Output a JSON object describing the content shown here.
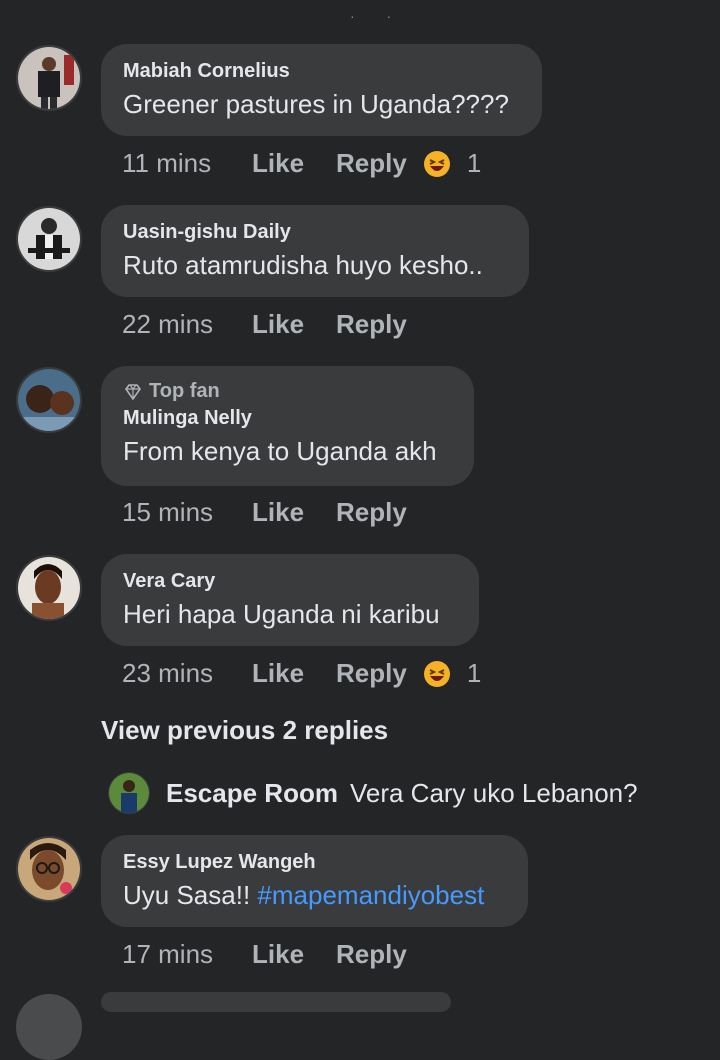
{
  "comments": [
    {
      "author": "Mabiah Cornelius",
      "text": "Greener pastures in Uganda????",
      "time": "11 mins",
      "like": "Like",
      "reply": "Reply",
      "reaction_count": "1",
      "top_fan": ""
    },
    {
      "author": "Uasin-gishu Daily",
      "text": "Ruto atamrudisha huyo kesho..",
      "time": "22 mins",
      "like": "Like",
      "reply": "Reply",
      "reaction_count": "",
      "top_fan": ""
    },
    {
      "author": "Mulinga Nelly",
      "text": "From kenya to Uganda akh",
      "time": "15 mins",
      "like": "Like",
      "reply": "Reply",
      "reaction_count": "",
      "top_fan": "Top fan"
    },
    {
      "author": "Vera Cary",
      "text": "Heri hapa Uganda ni karibu",
      "time": "23 mins",
      "like": "Like",
      "reply": "Reply",
      "reaction_count": "1",
      "top_fan": ""
    },
    {
      "author": "Essy Lupez Wangeh",
      "text_prefix": "Uyu Sasa!! ",
      "hashtag": "#mapemandiyobest",
      "time": "17 mins",
      "like": "Like",
      "reply": "Reply",
      "reaction_count": "",
      "top_fan": ""
    }
  ],
  "view_previous": "View previous 2 replies",
  "reply_preview": {
    "name": "Escape Room",
    "text": "Vera Cary uko Lebanon?"
  },
  "colors": {
    "background": "#242526",
    "bubble": "#3a3b3c",
    "text": "#e4e6eb",
    "muted": "#b0b3b8",
    "hashtag": "#4599ff"
  },
  "icons": {
    "reaction": "laughing-emoji-icon",
    "top_fan": "diamond-icon"
  }
}
